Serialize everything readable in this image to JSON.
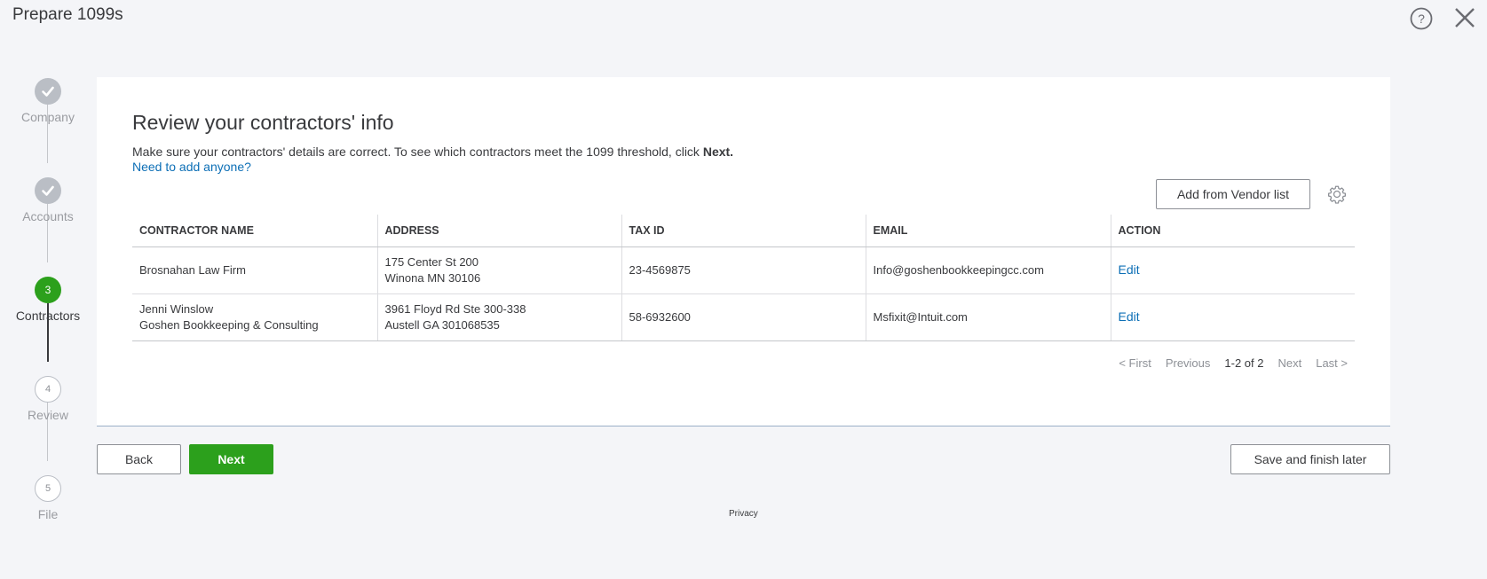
{
  "header": {
    "title": "Prepare 1099s"
  },
  "stepper": {
    "steps": [
      {
        "number": "",
        "label": "Company",
        "state": "done"
      },
      {
        "number": "",
        "label": "Accounts",
        "state": "done"
      },
      {
        "number": "3",
        "label": "Contractors",
        "state": "active"
      },
      {
        "number": "4",
        "label": "Review",
        "state": "todo"
      },
      {
        "number": "5",
        "label": "File",
        "state": "todo"
      }
    ]
  },
  "main": {
    "heading": "Review your contractors' info",
    "subtitle_prefix": "Make sure your contractors' details are correct. To see which contractors meet the 1099 threshold, click ",
    "subtitle_bold": "Next.",
    "add_link": "Need to add anyone?",
    "vendor_button": "Add from Vendor list",
    "table": {
      "columns": [
        "CONTRACTOR NAME",
        "ADDRESS",
        "TAX ID",
        "EMAIL",
        "ACTION"
      ],
      "rows": [
        {
          "name_line1": "Brosnahan Law Firm",
          "name_line2": "",
          "address_line1": "175 Center St 200",
          "address_line2": "Winona MN 30106",
          "tax_id": "23-4569875",
          "email": "Info@goshenbookkeepingcc.com",
          "action": "Edit"
        },
        {
          "name_line1": "Jenni Winslow",
          "name_line2": "Goshen Bookkeeping & Consulting",
          "address_line1": "3961 Floyd Rd Ste 300-338",
          "address_line2": "Austell GA 301068535",
          "tax_id": "58-6932600",
          "email": "Msfixit@Intuit.com",
          "action": "Edit"
        }
      ]
    },
    "pager": {
      "first": "< First",
      "previous": "Previous",
      "range": "1-2 of 2",
      "next": "Next",
      "last": "Last >"
    }
  },
  "footer": {
    "back": "Back",
    "next": "Next",
    "save": "Save and finish later",
    "privacy": "Privacy"
  },
  "colors": {
    "accent_green": "#2ca01c",
    "link_blue": "#0d6fb6",
    "text": "#393a3d",
    "background": "#f4f5f8"
  },
  "icons": {
    "help": "help-circle-icon",
    "close": "close-icon",
    "settings": "gear-icon",
    "checkmark": "checkmark-icon"
  }
}
